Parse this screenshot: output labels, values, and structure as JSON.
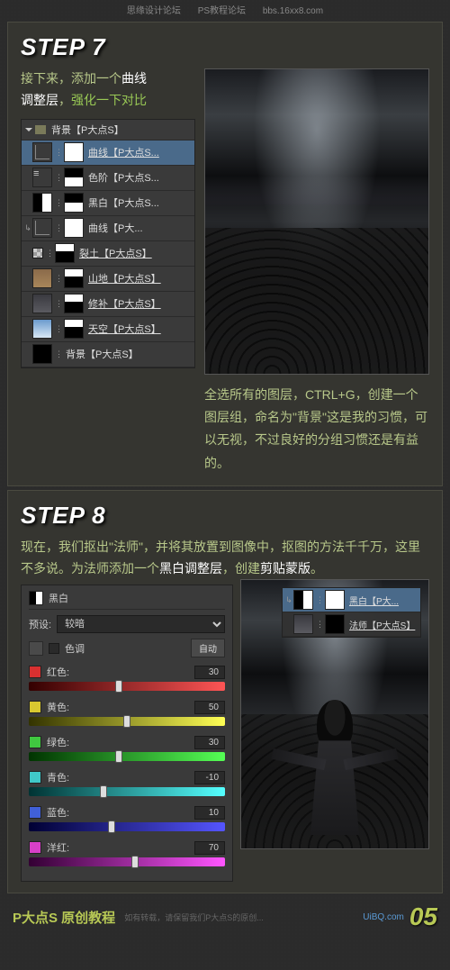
{
  "topbar": {
    "a": "思缘设计论坛",
    "b": "PS教程论坛",
    "c": "bbs.16xx8.com"
  },
  "step7": {
    "title": "STEP 7",
    "line1a": "接下来，添加一个",
    "line1b": "曲线",
    "line2a": "调整层",
    "line2b": "，",
    "line2c": "强化一下对比",
    "group_name": "背景【P大点S】",
    "layers": [
      {
        "name": "曲线【P大点S...",
        "type": "curves",
        "mask": "white",
        "sel": true
      },
      {
        "name": "色阶【P大点S...",
        "type": "levels",
        "mask": "grad"
      },
      {
        "name": "黑白【P大点S...",
        "type": "bw",
        "mask": "grad"
      },
      {
        "name": "曲线【P大...",
        "type": "curves",
        "mask": "white",
        "clip": true
      },
      {
        "name": "裂土【P大点S】",
        "type": "img",
        "thumb": "chk",
        "mask": "grad2",
        "u": true
      },
      {
        "name": "山地【P大点S】",
        "type": "img",
        "thumb": "dirt",
        "mask": "grad2",
        "u": true
      },
      {
        "name": "修补【P大点S】",
        "type": "img",
        "thumb": "rock",
        "mask": "grad2",
        "u": true
      },
      {
        "name": "天空【P大点S】",
        "type": "img",
        "thumb": "sky",
        "mask": "grad2",
        "u": true
      },
      {
        "name": "背景【P大点S】",
        "type": "img",
        "thumb": "black"
      }
    ],
    "text2": "全选所有的图层，CTRL+G，创建一个图层组，命名为\"背景\"这是我的习惯，可以无视，不过良好的分组习惯还是有益的。"
  },
  "step8": {
    "title": "STEP 8",
    "t1": "现在，我们抠出\"法师\"，并将其放置到图像中，抠图的方法千千万，这里不多说。为法师添加一个",
    "t1b": "黑白调整层",
    "t1c": "，创建",
    "t1d": "剪贴蒙版",
    "t1e": "。",
    "mini": [
      {
        "name": "黑白【P大...",
        "type": "bw",
        "mask": "white",
        "clip": true,
        "sel": true
      },
      {
        "name": "法师【P大点S】",
        "type": "img",
        "thumb": "rock",
        "mask": "fig",
        "u": true
      }
    ],
    "bw": {
      "title": "黑白",
      "preset_lbl": "预设:",
      "preset": "较暗",
      "auto": "自动",
      "tint": "色调",
      "rows": [
        {
          "label": "红色:",
          "color": "#d83030",
          "val": 30,
          "min": -200,
          "max": 300,
          "grad": "linear-gradient(90deg,#300,#f55)"
        },
        {
          "label": "黄色:",
          "color": "#d8c830",
          "val": 50,
          "min": -200,
          "max": 300,
          "grad": "linear-gradient(90deg,#330,#ff5)"
        },
        {
          "label": "绿色:",
          "color": "#40c840",
          "val": 30,
          "min": -200,
          "max": 300,
          "grad": "linear-gradient(90deg,#030,#5f5)"
        },
        {
          "label": "青色:",
          "color": "#40c8c8",
          "val": -10,
          "min": -200,
          "max": 300,
          "grad": "linear-gradient(90deg,#033,#5ff)"
        },
        {
          "label": "蓝色:",
          "color": "#4060d8",
          "val": 10,
          "min": -200,
          "max": 300,
          "grad": "linear-gradient(90deg,#003,#55f)"
        },
        {
          "label": "洋红:",
          "color": "#d840c8",
          "val": 70,
          "min": -200,
          "max": 300,
          "grad": "linear-gradient(90deg,#303,#f5f)"
        }
      ]
    }
  },
  "footer": {
    "brand": "P大点S 原创教程",
    "note": "如有转载，请保留我们P大点S的原创...",
    "uib": "UiBQ.com",
    "page": "05"
  }
}
